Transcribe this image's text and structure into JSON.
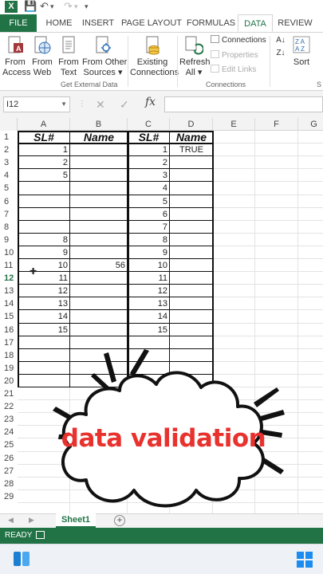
{
  "app": {
    "name": "Excel"
  },
  "ribbon": {
    "tabs": [
      "FILE",
      "HOME",
      "INSERT",
      "PAGE LAYOUT",
      "FORMULAS",
      "DATA",
      "REVIEW"
    ],
    "active_tab": "DATA",
    "buttons": {
      "from_access": [
        "From",
        "Access"
      ],
      "from_web": [
        "From",
        "Web"
      ],
      "from_text": [
        "From",
        "Text"
      ],
      "from_other": [
        "From Other",
        "Sources ▾"
      ],
      "existing": [
        "Existing",
        "Connections"
      ],
      "refresh": [
        "Refresh",
        "All ▾"
      ],
      "sort": "Sort"
    },
    "connections_items": [
      "Connections",
      "Properties",
      "Edit Links"
    ],
    "group_labels": {
      "external": "Get External Data",
      "connections": "Connections",
      "cut": "S"
    }
  },
  "formula_bar": {
    "name_box": "I12",
    "fx": "fx",
    "value": ""
  },
  "grid": {
    "columns": [
      "A",
      "B",
      "C",
      "D",
      "E",
      "F",
      "G"
    ],
    "rows": [
      "1",
      "2",
      "3",
      "4",
      "5",
      "6",
      "7",
      "8",
      "9",
      "10",
      "11",
      "12",
      "13",
      "14",
      "15",
      "16",
      "17",
      "18",
      "19",
      "20",
      "21",
      "22",
      "23",
      "24",
      "25",
      "26",
      "27",
      "28",
      "29"
    ],
    "selected_row": "12",
    "headers": {
      "A": "SL#",
      "B": "Name",
      "C": "SL#",
      "D": "Name"
    },
    "colA": [
      "1",
      "2",
      "5",
      "",
      "",
      "",
      "",
      "8",
      "9",
      "10",
      "11",
      "12",
      "13",
      "14",
      "15"
    ],
    "colB": [
      "",
      "",
      "",
      "",
      "",
      "",
      "",
      "",
      "",
      "56",
      "",
      "",
      "",
      "",
      ""
    ],
    "colC": [
      "1",
      "2",
      "3",
      "4",
      "5",
      "6",
      "7",
      "8",
      "9",
      "10",
      "11",
      "12",
      "13",
      "14",
      "15"
    ],
    "colD": [
      "TRUE",
      "",
      "",
      "",
      "",
      "",
      "",
      "",
      "",
      "",
      "",
      "",
      "",
      "",
      ""
    ]
  },
  "overlay": {
    "text": "data validation",
    "color": "#e8322e"
  },
  "sheets": {
    "active": "Sheet1",
    "add_label": "+"
  },
  "status": {
    "text": "READY"
  },
  "colors": {
    "excel_green": "#217346",
    "text_red": "#e8322e"
  }
}
